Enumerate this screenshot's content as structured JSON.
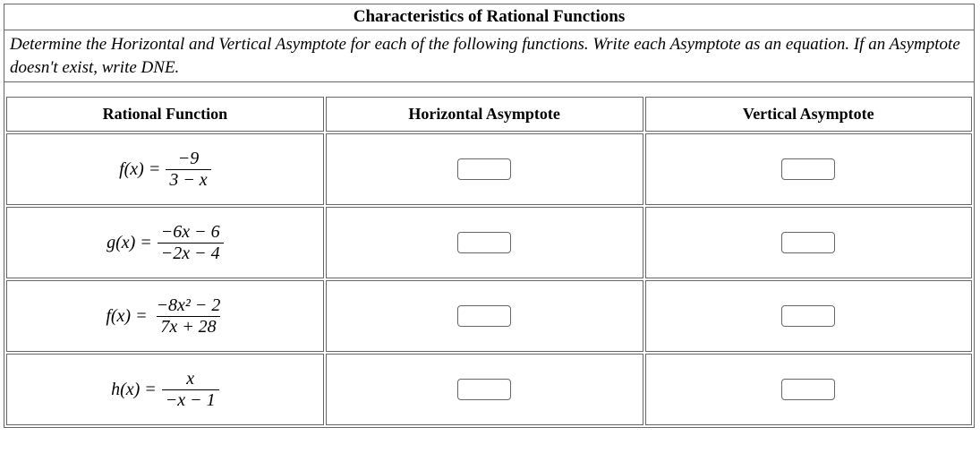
{
  "title": "Characteristics of Rational Functions",
  "instructions_pre": "Determine the Horizontal and Vertical Asymptote for each of the following functions. Write each Asymptote as an equation. If an Asymptote doesn't exist, write ",
  "instructions_dne": "DNE",
  "instructions_post": ".",
  "headers": {
    "func": "Rational Function",
    "ha": "Horizontal Asymptote",
    "va": "Vertical Asymptote"
  },
  "rows": [
    {
      "lhs": "f(x) =",
      "num": "−9",
      "den": "3 − x",
      "ha": "",
      "va": ""
    },
    {
      "lhs": "g(x) =",
      "num": "−6x − 6",
      "den": "−2x − 4",
      "ha": "",
      "va": ""
    },
    {
      "lhs": "f(x) =",
      "num": "−8x² − 2",
      "den": "7x + 28",
      "ha": "",
      "va": ""
    },
    {
      "lhs": "h(x) =",
      "num": "x",
      "den": "−x − 1",
      "ha": "",
      "va": ""
    }
  ]
}
